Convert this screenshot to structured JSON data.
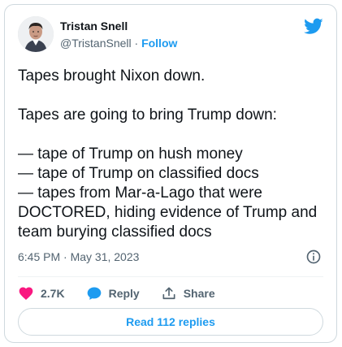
{
  "author": {
    "display_name": "Tristan Snell",
    "handle": "@TristanSnell",
    "separator": " · ",
    "follow_label": "Follow"
  },
  "tweet": {
    "lines": [
      "Tapes brought Nixon down.",
      "",
      "Tapes are going to bring Trump down:",
      "",
      "— tape of Trump on hush money",
      "— tape of Trump on classified docs",
      "— tapes from Mar-a-Lago that were DOCTORED, hiding evidence of Trump and team burying classified docs"
    ],
    "timestamp": "6:45 PM · May 31, 2023"
  },
  "actions": {
    "like_count": "2.7K",
    "reply_label": "Reply",
    "share_label": "Share"
  },
  "replies_button_label": "Read 112 replies",
  "icons": {
    "brand": "twitter-bird-icon",
    "info": "info-icon",
    "like": "heart-icon",
    "reply": "speech-bubble-icon",
    "share": "share-upload-icon"
  },
  "colors": {
    "accent": "#1d9bf0",
    "like": "#f91880",
    "text": "#0f1419",
    "muted": "#536471",
    "border": "#cfd9de"
  }
}
